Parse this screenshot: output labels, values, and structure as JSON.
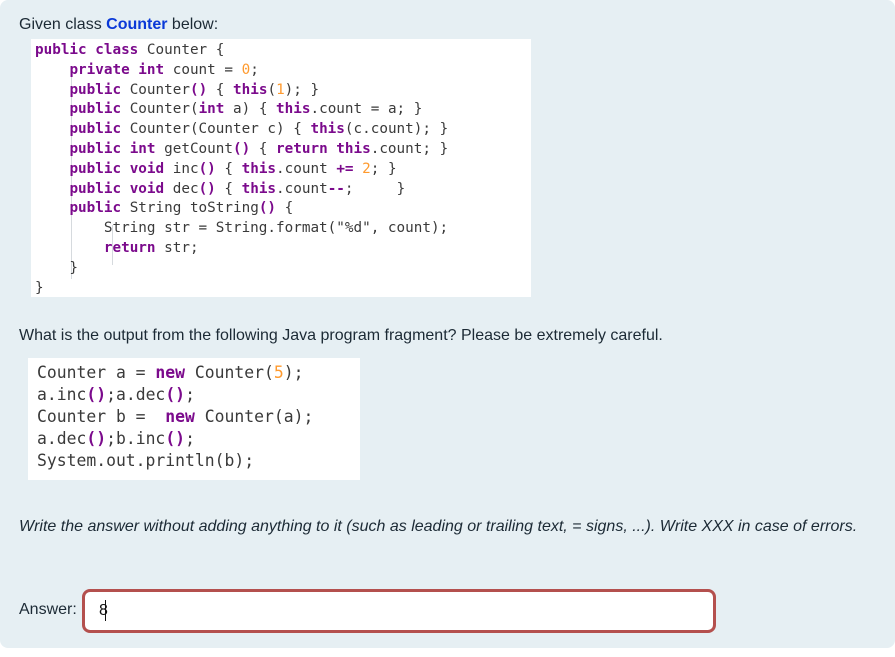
{
  "intro": {
    "prefix": "Given class ",
    "class_name": "Counter",
    "suffix": " below:"
  },
  "class_code": [
    [
      {
        "t": "public class",
        "k": "kw"
      },
      {
        "t": " Counter {"
      }
    ],
    [
      {
        "t": "    "
      },
      {
        "t": "private int",
        "k": "kw"
      },
      {
        "t": " count = "
      },
      {
        "t": "0",
        "k": "num"
      },
      {
        "t": ";"
      }
    ],
    [
      {
        "t": "    "
      },
      {
        "t": "public",
        "k": "kw"
      },
      {
        "t": " Counter"
      },
      {
        "t": "()",
        "k": "kw"
      },
      {
        "t": " { "
      },
      {
        "t": "this",
        "k": "kw"
      },
      {
        "t": "("
      },
      {
        "t": "1",
        "k": "num"
      },
      {
        "t": "); }"
      }
    ],
    [
      {
        "t": "    "
      },
      {
        "t": "public",
        "k": "kw"
      },
      {
        "t": " Counter("
      },
      {
        "t": "int",
        "k": "kw"
      },
      {
        "t": " a) { "
      },
      {
        "t": "this",
        "k": "kw"
      },
      {
        "t": ".count = a; }"
      }
    ],
    [
      {
        "t": "    "
      },
      {
        "t": "public",
        "k": "kw"
      },
      {
        "t": " Counter(Counter c) { "
      },
      {
        "t": "this",
        "k": "kw"
      },
      {
        "t": "(c.count); }"
      }
    ],
    [
      {
        "t": "    "
      },
      {
        "t": "public int",
        "k": "kw"
      },
      {
        "t": " getCount"
      },
      {
        "t": "()",
        "k": "kw"
      },
      {
        "t": " { "
      },
      {
        "t": "return this",
        "k": "kw"
      },
      {
        "t": ".count; }"
      }
    ],
    [
      {
        "t": "    "
      },
      {
        "t": "public void",
        "k": "kw"
      },
      {
        "t": " inc"
      },
      {
        "t": "()",
        "k": "kw"
      },
      {
        "t": " { "
      },
      {
        "t": "this",
        "k": "kw"
      },
      {
        "t": ".count "
      },
      {
        "t": "+=",
        "k": "kw"
      },
      {
        "t": " "
      },
      {
        "t": "2",
        "k": "num"
      },
      {
        "t": "; }"
      }
    ],
    [
      {
        "t": "    "
      },
      {
        "t": "public void",
        "k": "kw"
      },
      {
        "t": " dec"
      },
      {
        "t": "()",
        "k": "kw"
      },
      {
        "t": " { "
      },
      {
        "t": "this",
        "k": "kw"
      },
      {
        "t": ".count"
      },
      {
        "t": "--",
        "k": "kw"
      },
      {
        "t": ";     }"
      }
    ],
    [
      {
        "t": "    "
      },
      {
        "t": "public",
        "k": "kw"
      },
      {
        "t": " String toString"
      },
      {
        "t": "()",
        "k": "kw"
      },
      {
        "t": " {"
      }
    ],
    [
      {
        "t": "        String str = String.format(\"%d\", count);"
      }
    ],
    [
      {
        "t": "        "
      },
      {
        "t": "return",
        "k": "kw"
      },
      {
        "t": " str;"
      }
    ],
    [
      {
        "t": "    }"
      }
    ],
    [
      {
        "t": "}"
      }
    ]
  ],
  "question": "What is the output from the following Java program fragment? Please be extremely careful.",
  "program_code": [
    [
      {
        "t": "Counter a = "
      },
      {
        "t": "new",
        "k": "kw"
      },
      {
        "t": " Counter("
      },
      {
        "t": "5",
        "k": "num"
      },
      {
        "t": ");"
      }
    ],
    [
      {
        "t": "a.inc"
      },
      {
        "t": "()",
        "k": "kw"
      },
      {
        "t": ";a.dec"
      },
      {
        "t": "()",
        "k": "kw"
      },
      {
        "t": ";"
      }
    ],
    [
      {
        "t": "Counter b =  "
      },
      {
        "t": "new",
        "k": "kw"
      },
      {
        "t": " Counter(a);"
      }
    ],
    [
      {
        "t": "a.dec"
      },
      {
        "t": "()",
        "k": "kw"
      },
      {
        "t": ";b.inc"
      },
      {
        "t": "()",
        "k": "kw"
      },
      {
        "t": ";"
      }
    ],
    [
      {
        "t": "System.out.println(b);"
      }
    ]
  ],
  "instruction": "Write the answer without adding anything to it (such as leading or trailing text, = signs, ...). Write XXX in case of errors.",
  "answer": {
    "label": "Answer:",
    "value": "8"
  },
  "colors": {
    "keyword": "#7b0a8c",
    "number": "#ff9a2e",
    "class_name": "#0a39d8",
    "answer_border": "#b4504e",
    "panel_bg": "#e6eff3"
  }
}
